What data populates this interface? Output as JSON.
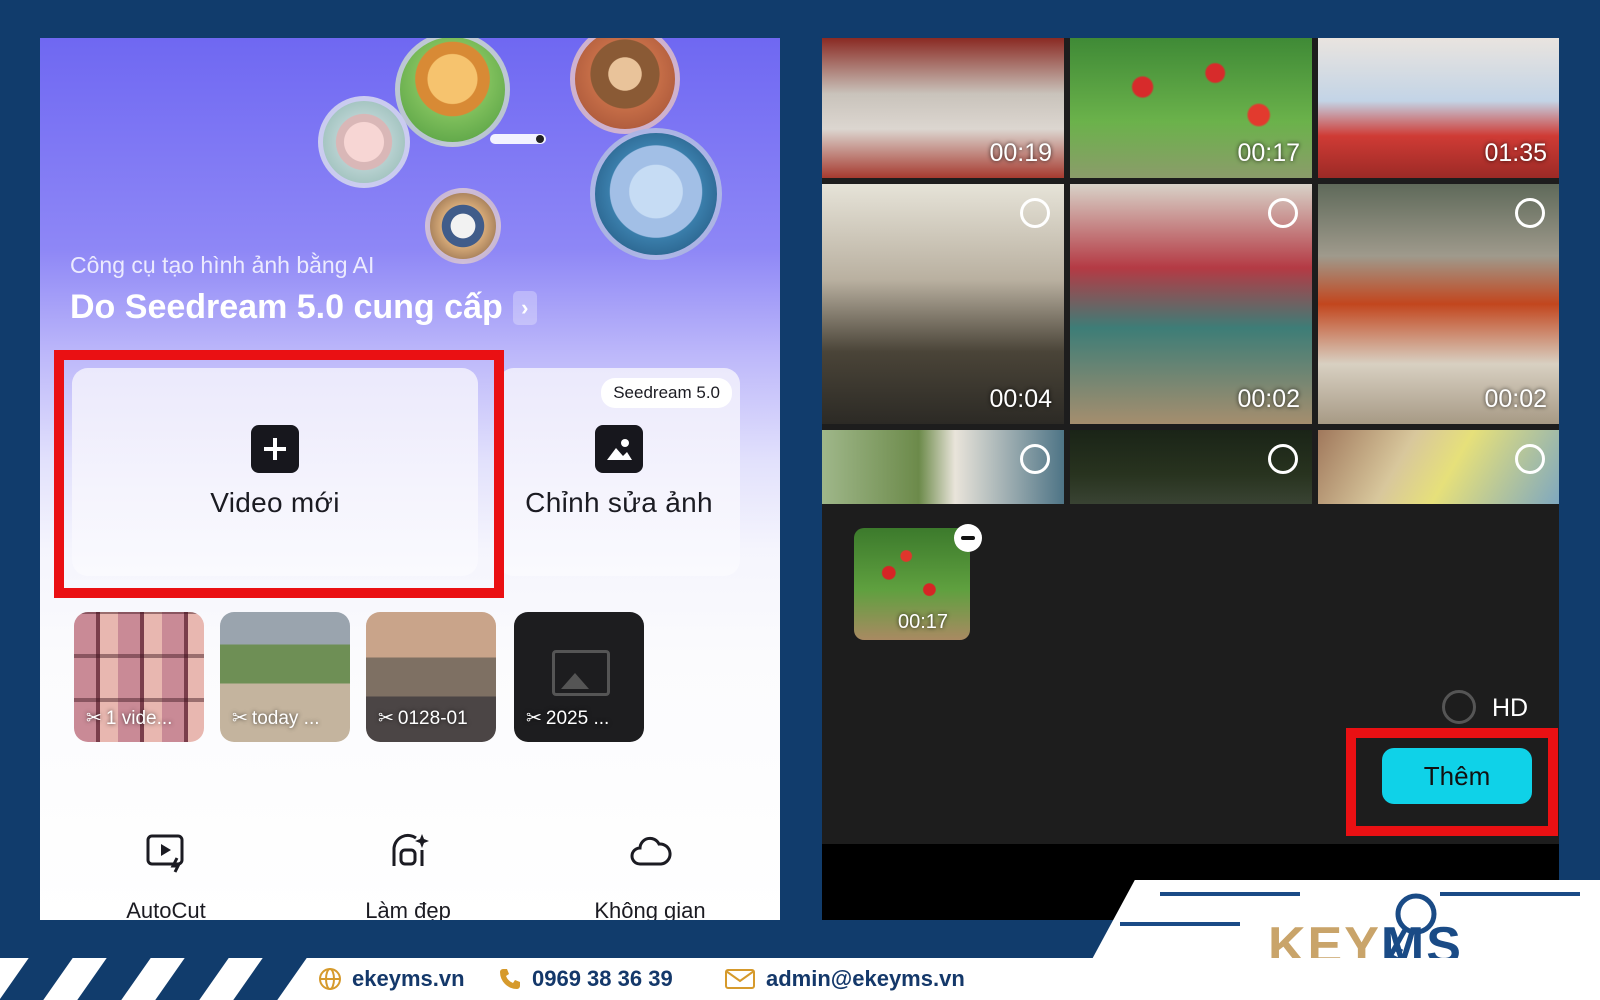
{
  "left_app": {
    "hero": {
      "subtitle": "Công cụ tạo hình ảnh bằng AI",
      "title": "Do Seedream 5.0 cung cấp",
      "chevron_icon": "chevron-right-icon"
    },
    "cards": {
      "new_video": {
        "label": "Video mới",
        "icon": "plus-square-icon"
      },
      "edit_photo": {
        "label": "Chỉnh sửa ảnh",
        "badge": "Seedream 5.0",
        "icon": "image-icon"
      }
    },
    "drafts": [
      {
        "label": "1 vide..."
      },
      {
        "label": "today ..."
      },
      {
        "label": "0128-01"
      },
      {
        "label": "2025 ..."
      }
    ],
    "tools": [
      {
        "label": "AutoCut",
        "icon": "autocut-icon"
      },
      {
        "label": "Làm đẹp",
        "icon": "beauty-icon"
      },
      {
        "label": "Không gian",
        "icon": "cloud-icon"
      }
    ]
  },
  "right_app": {
    "gallery": [
      {
        "duration": "00:19"
      },
      {
        "duration": "00:17"
      },
      {
        "duration": "01:35"
      },
      {
        "duration": "00:04"
      },
      {
        "duration": "00:02"
      },
      {
        "duration": "00:02"
      },
      {
        "duration": ""
      },
      {
        "duration": ""
      },
      {
        "duration": ""
      }
    ],
    "selected": {
      "duration": "00:17"
    },
    "hd_label": "HD",
    "add_button": "Thêm"
  },
  "branding": {
    "website": "ekeyms.vn",
    "phone": "0969 38 36 39",
    "email": "admin@ekeyms.vn",
    "logo_key": "KEY",
    "logo_ms": "MS"
  },
  "colors": {
    "highlight": "#ea1013",
    "accent_button": "#0fd2e8",
    "background": "#113c6c"
  }
}
